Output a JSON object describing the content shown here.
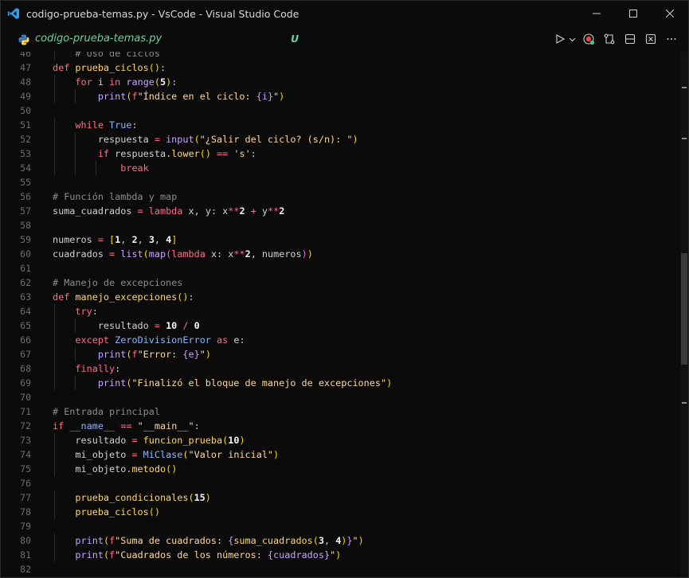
{
  "window": {
    "title": "codigo-prueba-temas.py - VsCode - Visual Studio Code",
    "app_icon": "vscode-icon",
    "controls": [
      "minimize-icon",
      "maximize-icon",
      "close-icon"
    ]
  },
  "editor_tab": {
    "file_name": "codigo-prueba-temas.py",
    "file_icon": "python-icon",
    "git_status": "U",
    "actions": [
      "run-python-file-icon",
      "run-dropdown-icon",
      "record-icon",
      "compare-changes-icon",
      "split-editor-icon",
      "close-editor-icon"
    ]
  },
  "colors": {
    "background": "#0b0b0b",
    "keyword": "#ff6c8b",
    "function": "#ffd76d",
    "builtin": "#c5a5ff",
    "string": "#ffd89c",
    "comment": "#8c8c8c",
    "file_name": "#6fcf9f"
  },
  "code_lines": [
    {
      "n": "46",
      "text": "    # Uso de ciclos"
    },
    {
      "n": "47",
      "text": "def prueba_ciclos():"
    },
    {
      "n": "48",
      "text": "    for i in range(5):"
    },
    {
      "n": "49",
      "text": "        print(f\"Índice en el ciclo: {i}\")"
    },
    {
      "n": "50",
      "text": ""
    },
    {
      "n": "51",
      "text": "    while True:"
    },
    {
      "n": "52",
      "text": "        respuesta = input(\"¿Salir del ciclo? (s/n): \")"
    },
    {
      "n": "53",
      "text": "        if respuesta.lower() == 's':"
    },
    {
      "n": "54",
      "text": "            break"
    },
    {
      "n": "55",
      "text": ""
    },
    {
      "n": "56",
      "text": "# Función lambda y map"
    },
    {
      "n": "57",
      "text": "suma_cuadrados = lambda x, y: x**2 + y**2"
    },
    {
      "n": "58",
      "text": ""
    },
    {
      "n": "59",
      "text": "numeros = [1, 2, 3, 4]"
    },
    {
      "n": "60",
      "text": "cuadrados = list(map(lambda x: x**2, numeros))"
    },
    {
      "n": "61",
      "text": ""
    },
    {
      "n": "62",
      "text": "# Manejo de excepciones"
    },
    {
      "n": "63",
      "text": "def manejo_excepciones():"
    },
    {
      "n": "64",
      "text": "    try:"
    },
    {
      "n": "65",
      "text": "        resultado = 10 / 0"
    },
    {
      "n": "66",
      "text": "    except ZeroDivisionError as e:"
    },
    {
      "n": "67",
      "text": "        print(f\"Error: {e}\")"
    },
    {
      "n": "68",
      "text": "    finally:"
    },
    {
      "n": "69",
      "text": "        print(\"Finalizó el bloque de manejo de excepciones\")"
    },
    {
      "n": "70",
      "text": ""
    },
    {
      "n": "71",
      "text": "# Entrada principal"
    },
    {
      "n": "72",
      "text": "if __name__ == \"__main__\":"
    },
    {
      "n": "73",
      "text": "    resultado = funcion_prueba(10)"
    },
    {
      "n": "74",
      "text": "    mi_objeto = MiClase(\"Valor inicial\")"
    },
    {
      "n": "75",
      "text": "    mi_objeto.metodo()"
    },
    {
      "n": "76",
      "text": ""
    },
    {
      "n": "77",
      "text": "    prueba_condicionales(15)"
    },
    {
      "n": "78",
      "text": "    prueba_ciclos()"
    },
    {
      "n": "79",
      "text": ""
    },
    {
      "n": "80",
      "text": "    print(f\"Suma de cuadrados: {suma_cuadrados(3, 4)}\")"
    },
    {
      "n": "81",
      "text": "    print(f\"Cuadrados de los números: {cuadrados}\")"
    },
    {
      "n": "82",
      "text": ""
    }
  ]
}
